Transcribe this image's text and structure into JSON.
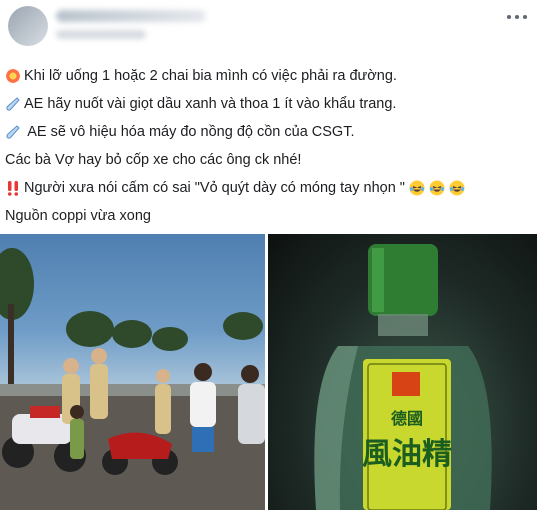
{
  "post": {
    "lines": [
      {
        "icon": "collision-icon",
        "text": "Khi lỡ uống 1 hoặc 2 chai bia mình có việc phải ra đường."
      },
      {
        "icon": "droplet-icon",
        "text": "AE hãy nuốt vài giọt dầu xanh và thoa 1 ít vào khẩu trang."
      },
      {
        "icon": "droplet-icon",
        "text": " AE sẽ vô hiệu hóa máy đo nồng độ cồn của CSGT."
      },
      {
        "icon": "",
        "text": "Các bà Vợ hay bỏ cốp xe cho các ông ck nhé!"
      },
      {
        "icon": "double-exclamation-icon",
        "text": "Người xưa nói cấm có sai \"Vỏ quýt dày có móng tay nhọn \"",
        "trailing_icons": [
          "laughing-face-icon",
          "laughing-face-icon",
          "laughing-face-icon"
        ]
      },
      {
        "icon": "",
        "text": "Nguồn coppi vừa xong"
      }
    ]
  },
  "bottle_label": {
    "line1": "德國",
    "line2": "風油精"
  },
  "colors": {
    "text": "#1c1e21",
    "link_icon": "#606770"
  }
}
